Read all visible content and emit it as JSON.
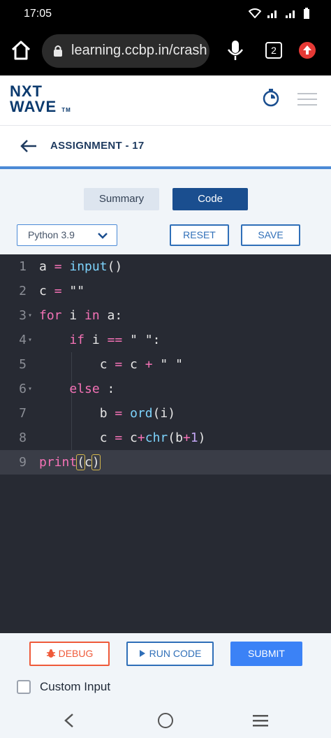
{
  "status_bar": {
    "time": "17:05",
    "icons": [
      "wifi-icon",
      "signal-icon",
      "signal-icon",
      "battery-icon"
    ]
  },
  "browser": {
    "url": "learning.ccbp.in/crash",
    "tab_count": "2"
  },
  "header": {
    "logo_line1": "NXT",
    "logo_line2": "WAVE",
    "logo_tm": "TM"
  },
  "assignment": {
    "title": "ASSIGNMENT - 17"
  },
  "tabs": {
    "summary": "Summary",
    "code": "Code",
    "active": "Code"
  },
  "toolbar": {
    "language": "Python 3.9",
    "reset": "RESET",
    "save": "SAVE"
  },
  "editor": {
    "line_numbers": [
      "1",
      "2",
      "3",
      "4",
      "5",
      "6",
      "7",
      "8",
      "9"
    ],
    "lines": [
      "a = input()",
      "c = \"\"",
      "for i in a:",
      "    if i == \" \":",
      "        c = c + \" \"",
      "    else :",
      "        b = ord(i)",
      "        c = c+chr(b+1)",
      "print(c)"
    ],
    "active_line": "9"
  },
  "actions": {
    "debug": "DEBUG",
    "run": "RUN CODE",
    "submit": "SUBMIT",
    "custom_input": "Custom Input"
  },
  "colors": {
    "primary": "#1a4e8f",
    "accent": "#3b82f6",
    "debug": "#ef5a3a",
    "editor_bg": "#272a33",
    "keyword": "#f472b6",
    "builtin": "#7dd3fc"
  }
}
